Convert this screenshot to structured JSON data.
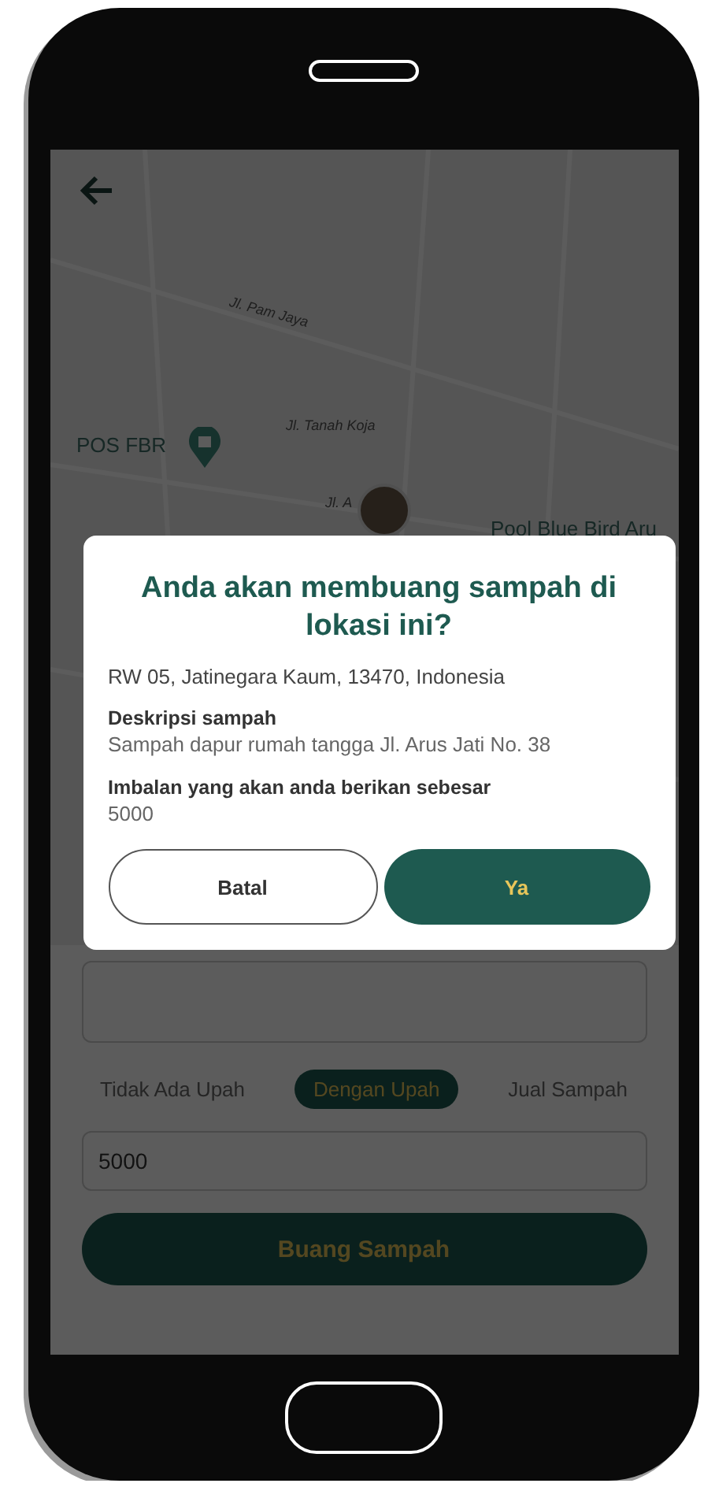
{
  "map": {
    "labels": [
      {
        "text": "Jl. Pam Jaya",
        "kind": "street"
      },
      {
        "text": "Jl. Tanah Koja",
        "kind": "street"
      },
      {
        "text": "POS FBR",
        "kind": "place"
      },
      {
        "text": "Jl. A",
        "kind": "street"
      },
      {
        "text": "Pool Blue Bird Aru",
        "kind": "place"
      }
    ]
  },
  "form": {
    "reward_tabs": [
      {
        "label": "Tidak Ada Upah",
        "selected": false
      },
      {
        "label": "Dengan Upah",
        "selected": true
      },
      {
        "label": "Jual Sampah",
        "selected": false
      }
    ],
    "amount_input": {
      "value": "5000"
    },
    "submit_button": {
      "label": "Buang Sampah"
    }
  },
  "dialog": {
    "title": "Anda akan membuang sampah di lokasi ini?",
    "address": "RW 05, Jatinegara Kaum, 13470, Indonesia",
    "sections": [
      {
        "label": "Deskripsi sampah",
        "value": "Sampah dapur rumah tangga Jl. Arus Jati No. 38"
      },
      {
        "label": "Imbalan yang akan anda berikan sebesar",
        "value": "5000"
      }
    ],
    "buttons": [
      {
        "label": "Batal",
        "kind": "secondary"
      },
      {
        "label": "Ya",
        "kind": "primary"
      }
    ]
  }
}
